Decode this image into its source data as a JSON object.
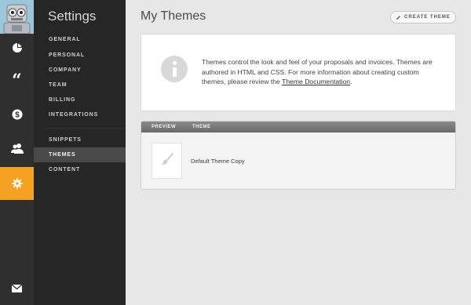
{
  "rail": {
    "items": [
      {
        "name": "dashboard",
        "icon": "pie-chart-icon"
      },
      {
        "name": "proposals",
        "icon": "quote-icon"
      },
      {
        "name": "invoices",
        "icon": "dollar-icon"
      },
      {
        "name": "clients",
        "icon": "users-icon"
      },
      {
        "name": "settings",
        "icon": "gear-icon",
        "active": true
      },
      {
        "name": "messages",
        "icon": "mail-icon"
      }
    ],
    "active_color": "#f5a223"
  },
  "nav": {
    "title": "Settings",
    "items": [
      "GENERAL",
      "PERSONAL",
      "COMPANY",
      "TEAM",
      "BILLING",
      "INTEGRATIONS"
    ],
    "items2": [
      "SNIPPETS",
      "THEMES",
      "CONTENT"
    ],
    "active": "THEMES"
  },
  "main": {
    "title": "My Themes",
    "create_button": "CREATE THEME",
    "info": {
      "text_before_link": "Themes control the look and feel of your proposals and invoices. Themes are authored in HTML and CSS. For more information about creating custom themes, please review the ",
      "link": "Theme Documentation",
      "text_after_link": "."
    },
    "table": {
      "headers": {
        "preview": "PREVIEW",
        "theme": "THEME"
      },
      "rows": [
        {
          "name": "Default Theme Copy",
          "icon": "brush-icon"
        }
      ]
    }
  }
}
